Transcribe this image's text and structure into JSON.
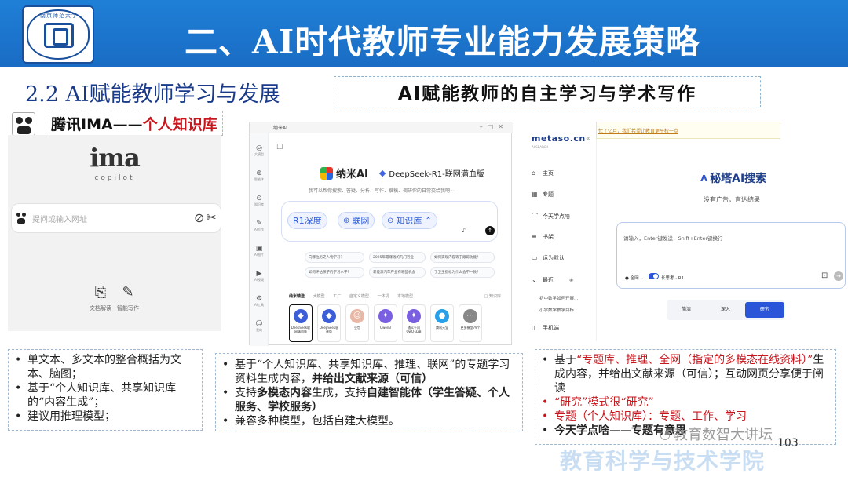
{
  "header": {
    "title": "二、AI时代教师专业能力发展策略",
    "logo_text": "南京师范大学"
  },
  "section": {
    "title": "2.2 AI赋能教师学习与发展",
    "topic": "AI赋能教师的自主学习与学术写作"
  },
  "ima": {
    "caption_name": "腾讯IMA——",
    "caption_sub": "个人知识库",
    "logo": "ima",
    "tagline": "copilot",
    "search_placeholder": "提问或输入网址",
    "tools": [
      {
        "label": "文档解读"
      },
      {
        "label": "智能写作"
      }
    ]
  },
  "nami": {
    "window_title": "纳米AI",
    "brand": "纳米AI",
    "model": "DeepSeek-R1-联网满血版",
    "tagline": "我可以帮你搜索、答疑、分析、写作、撰稿、调研你的日常交给我吧~",
    "rail": [
      "大模型",
      "智能体",
      "知识库",
      "AI写作",
      "AI图片",
      "AI视频",
      "AI工具",
      "我的"
    ],
    "chips": [
      "R1深度",
      "联网",
      "知识库"
    ],
    "suggestions": [
      "向哪位历史人物学习？",
      "2025年最赚钱的几门行业",
      "如何实现内容等于跟踪功能？",
      "如何评估孩子的学习水平？",
      "新能源汽车产业有哪些机会",
      "了卫生指标为什么会不一致？"
    ],
    "tabs": [
      "纳米精选",
      "大模型",
      "工厂",
      "自定义模型",
      "一体机",
      "本地模型"
    ],
    "tabs_right": "□ 知识库",
    "cards": [
      {
        "label": "DeepSeek联网满血版"
      },
      {
        "label": "DeepSeek极速版"
      },
      {
        "label": "豆包"
      },
      {
        "label": "Qwen3"
      },
      {
        "label": "通义千问QwQ-32B"
      },
      {
        "label": "腾讯元宝"
      },
      {
        "label": "更多模型79个"
      }
    ]
  },
  "metaso": {
    "logo": "metaso.cn",
    "logo_sub": "AI SEARCH",
    "banner": "忙了亿月，我们希望让教育更平权一点",
    "brand": "秘塔AI搜索",
    "tagline": "没有广告，直达结果",
    "nav": [
      {
        "label": "主页"
      },
      {
        "label": "专题"
      },
      {
        "label": "今天学点啥"
      },
      {
        "label": "书架"
      },
      {
        "label": "运为默认"
      },
      {
        "label": "最近"
      }
    ],
    "recent": [
      "初中数学如何开展...",
      "小学数学教学目标..."
    ],
    "mobile": "手机端",
    "input_placeholder": "请输入，Enter键发送，Shift+Enter键换行",
    "scope": "全网",
    "long_think": "长思考 · R1",
    "modes": [
      "简洁",
      "深入",
      "研究"
    ]
  },
  "bullets1": [
    "单文本、多文本的整合概括为文本、脑图；",
    "基于“个人知识库、共享知识库的“内容生成”；",
    "建议用推理模型；"
  ],
  "bullets2": {
    "b1_a": "基于“个人知识库、共享知识库、推理、联网”的专题学习资料生成内容，",
    "b1_b": "并给出文献来源（可信）",
    "b2_a": "支持",
    "b2_b": "多模态内容",
    "b2_c": "生成，支持",
    "b2_d": "自建智能体（学生答疑、个人服务、学校服务）",
    "b3": "兼容多种模型，包括自建大模型。"
  },
  "bullets3": {
    "b1_a": "基于",
    "b1_b": "“专题库、推理、全网（指定的多模态在线资料）”",
    "b1_c": "生成内容，并给出文献来源（可信）；互动网页分享便于阅读",
    "b2": "“研究”模式很“研究”",
    "b3": "专题（个人知识库）：专题、工作、学习",
    "b4_a": "今天学点啥——",
    "b4_b": "专题有意思"
  },
  "footer": {
    "watermark": "教育数智大讲坛",
    "page": "103",
    "school": "教育科学与技术学院"
  }
}
